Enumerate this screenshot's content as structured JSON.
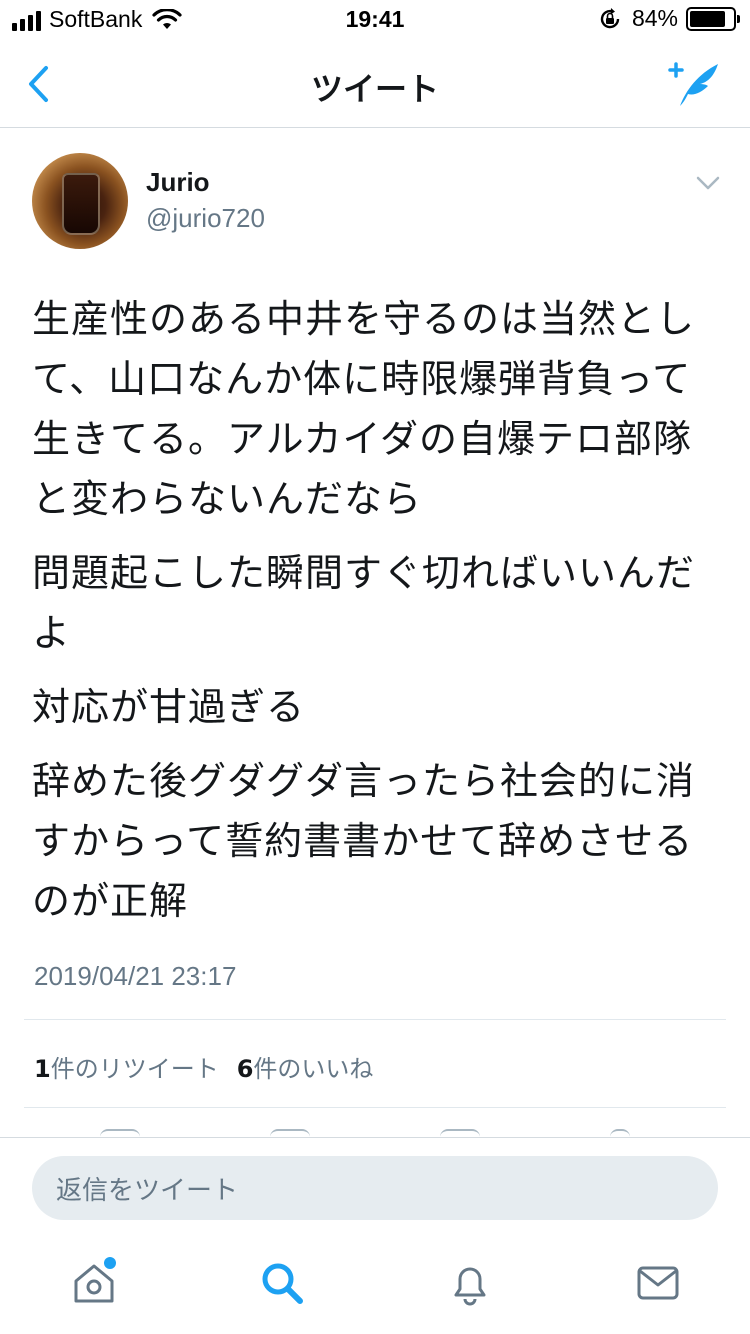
{
  "status_bar": {
    "carrier": "SoftBank",
    "time": "19:41",
    "battery_percent": "84%",
    "battery_level": 0.84
  },
  "nav": {
    "title": "ツイート",
    "back_icon": "chevron-left-icon",
    "compose_icon": "compose-tweet-icon"
  },
  "tweet": {
    "user_name": "Jurio",
    "user_handle": "@jurio720",
    "paragraphs": [
      "生産性のある中井を守るのは当然として、山口なんか体に時限爆弾背負って生きてる。アルカイダの自爆テロ部隊と変わらないんだなら",
      "問題起こした瞬間すぐ切ればいいんだよ",
      "対応が甘過ぎる",
      "辞めた後グダグダ言ったら社会的に消すからって誓約書書かせて辞めさせるのが正解"
    ],
    "timestamp": "2019/04/21 23:17",
    "retweet_count": "1",
    "retweet_label": "件のリツイート",
    "like_count": "6",
    "like_label": "件のいいね"
  },
  "reply": {
    "placeholder": "返信をツイート"
  },
  "tabbar": {
    "items": [
      "home-icon",
      "search-icon",
      "notifications-icon",
      "messages-icon"
    ]
  },
  "colors": {
    "accent": "#1da1f2",
    "text": "#14171a",
    "secondary": "#657786",
    "border": "#e1e8ed"
  }
}
